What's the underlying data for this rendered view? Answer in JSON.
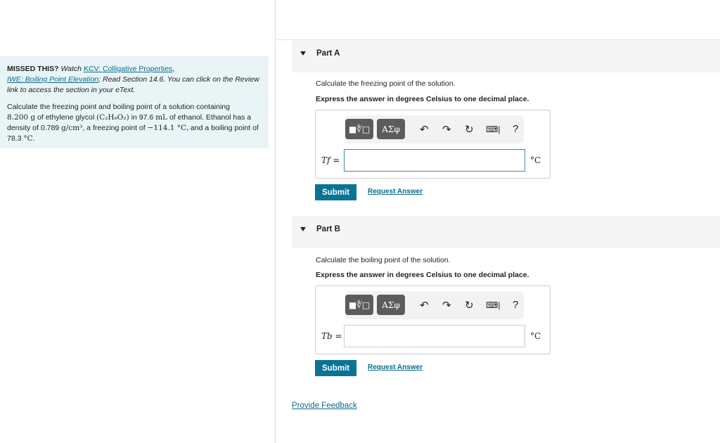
{
  "intro": {
    "missed": "MISSED THIS?",
    "watch": "Watch",
    "link1": "KCV: Colligative Properties",
    "comma": ",",
    "link2": "IWE: Boiling Point Elevation",
    "rest": "; Read Section 14.6. You can click on the Review link to access the section in your eText."
  },
  "problem": {
    "t1": "Calculate the freezing point and boiling point of a solution containing",
    "m1": "8.200 g",
    "t2": " of ethylene glycol ",
    "m2": "(C₂H₆O₂)",
    "t3": " in 97.6 ",
    "m3": "mL",
    "t4": " of ethanol. Ethanol has a density of 0.789 ",
    "m4": "g/cm³",
    "t5": ", a freezing point of ",
    "m5": "−114.1 °C",
    "t6": ", and a boiling point of 78.3 ",
    "m6": "°C",
    "t7": "."
  },
  "parts": [
    {
      "title": "Part A",
      "question": "Calculate the freezing point of the solution.",
      "instruction": "Express the answer in degrees Celsius to one decimal place.",
      "label": "Tf =",
      "unit": "°C",
      "value": "",
      "submit": "Submit",
      "request": "Request Answer"
    },
    {
      "title": "Part B",
      "question": "Calculate the boiling point of the solution.",
      "instruction": "Express the answer in degrees Celsius to one decimal place.",
      "label": "Tb =",
      "unit": "°C",
      "value": "",
      "submit": "Submit",
      "request": "Request Answer"
    }
  ],
  "toolbar": {
    "templates": "■∜□",
    "symbols": "ΑΣφ",
    "undo": "↶",
    "redo": "↷",
    "reset": "↻",
    "keyboard": "⌨|",
    "help": "?"
  },
  "feedback": "Provide Feedback"
}
